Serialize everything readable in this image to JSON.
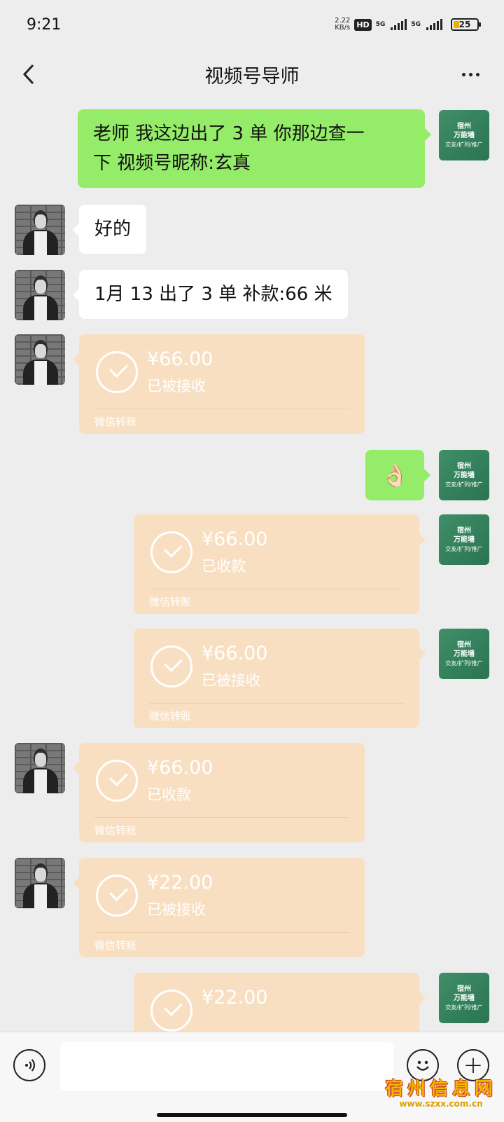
{
  "status_bar": {
    "time": "9:21",
    "net_speed_value": "2.22",
    "net_speed_unit": "KB/s",
    "hd_badge": "HD",
    "signal_1": "5G",
    "signal_2": "5G",
    "battery": "25"
  },
  "header": {
    "title": "视频号导师",
    "back_icon": "chevron-left-icon",
    "more_icon": "more-horizontal-icon"
  },
  "self_avatar": {
    "line1": "宿州",
    "line2": "万能墙",
    "line3": "交友/扩列/推广"
  },
  "messages": [
    {
      "side": "right",
      "type": "text",
      "text_line1": "老师 我这边出了 3 单 你那边查一",
      "text_line2": "下 视频号昵称:玄真"
    },
    {
      "side": "left",
      "type": "text",
      "text": "好的"
    },
    {
      "side": "left",
      "type": "text",
      "text": "1月 13 出了 3 单 补款:66 米"
    },
    {
      "side": "left",
      "type": "transfer",
      "amount": "¥66.00",
      "status": "已被接收",
      "label": "微信转账"
    },
    {
      "side": "right",
      "type": "emoji",
      "emoji": "👌🏻"
    },
    {
      "side": "right",
      "type": "transfer",
      "amount": "¥66.00",
      "status": "已收款",
      "label": "微信转账"
    },
    {
      "side": "right",
      "type": "transfer",
      "amount": "¥66.00",
      "status": "已被接收",
      "label": "微信转账"
    },
    {
      "side": "left",
      "type": "transfer",
      "amount": "¥66.00",
      "status": "已收款",
      "label": "微信转账"
    },
    {
      "side": "left",
      "type": "transfer",
      "amount": "¥22.00",
      "status": "已被接收",
      "label": "微信转账"
    },
    {
      "side": "right",
      "type": "transfer",
      "amount": "¥22.00",
      "status": "",
      "label": ""
    }
  ],
  "input_bar": {
    "voice_icon": "voice-icon",
    "emoji_icon": "smiley-icon",
    "plus_icon": "plus-icon",
    "plus_glyph": "+"
  },
  "watermark": {
    "main": "宿州信息网",
    "sub": "www.szxx.com.cn"
  }
}
